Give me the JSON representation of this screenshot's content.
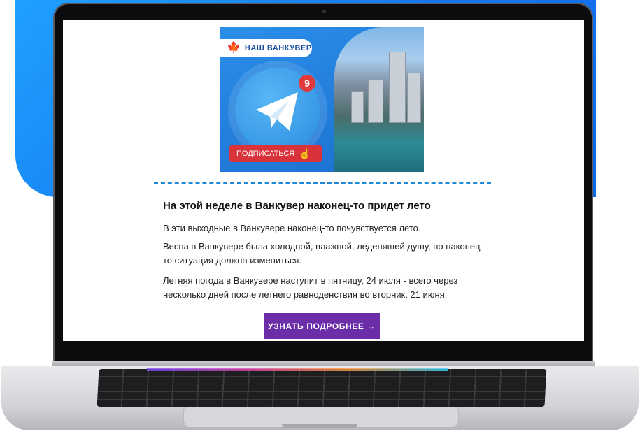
{
  "banner": {
    "logo_text": "НАШ ВАНКУВЕР",
    "badge_count": "9",
    "subscribe_label": "ПОДПИСАТЬСЯ"
  },
  "article": {
    "headline": "На этой неделе в Ванкувер наконец-то придет лето",
    "paragraphs": [
      "В эти выходные в Ванкувере наконец-то почувствуется лето.",
      "Весна в Ванкувере была холодной, влажной, леденящей душу, но наконец-то ситуация должна измениться.",
      "Летняя погода в Ванкувере наступит в пятницу, 24 июля - всего через несколько дней после летнего равноденствия во вторник, 21 июня."
    ],
    "cta_label": "УЗНАТЬ ПОДРОБНЕЕ →"
  },
  "colors": {
    "background_blue": "#1577f0",
    "cta_purple": "#6b2ea8",
    "subscribe_red": "#d8333a",
    "divider_blue": "#1d89d4"
  },
  "icons": [
    "maple-leaf-icon",
    "telegram-icon",
    "pointer-hand-icon"
  ]
}
